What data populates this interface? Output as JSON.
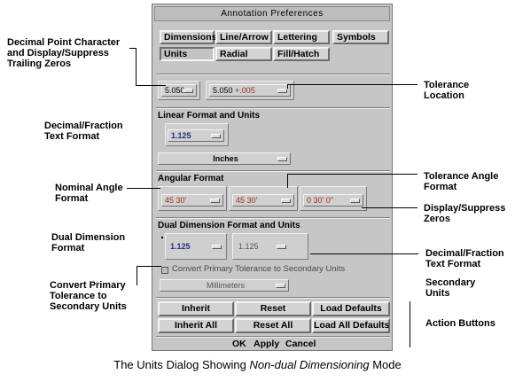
{
  "dialog": {
    "title": "Annotation Preferences",
    "tabs_row1": [
      "Dimensions",
      "Line/Arrow",
      "Lettering",
      "Symbols"
    ],
    "tabs_row2": [
      "Units",
      "Radial",
      "Fill/Hatch"
    ],
    "decimal_point_value": "5.050",
    "tolerance_value_main": "5.050",
    "tolerance_value_suffix": "+.005",
    "linear_section": "Linear Format and Units",
    "linear_value": "1.125",
    "linear_units": "Inches",
    "angular_section": "Angular Format",
    "angle_1": "45 30'",
    "angle_2": "45 30'",
    "angle_3": "0 30' 0\"",
    "dual_section": "Dual Dimension Format and Units",
    "dual_value_1": "1.125",
    "dual_value_2": "1.125",
    "convert_label": "Convert Primary Tolerance to Secondary Units",
    "secondary_units": "Millimeters",
    "actions": {
      "inherit": "Inherit",
      "reset": "Reset",
      "load_defaults": "Load Defaults",
      "inherit_all": "Inherit All",
      "reset_all": "Reset All",
      "load_all_defaults": "Load All Defaults"
    },
    "bottom": {
      "ok": "OK",
      "apply": "Apply",
      "cancel": "Cancel"
    }
  },
  "callouts": {
    "decimal_point": [
      "Decimal Point Character",
      "and Display/Suppress",
      "Trailing Zeros"
    ],
    "decimal_fraction_left": [
      "Decimal/Fraction",
      "Text Format"
    ],
    "nominal_angle": [
      "Nominal Angle",
      "Format"
    ],
    "dual_dimension": [
      "Dual Dimension",
      "Format"
    ],
    "convert_primary": [
      "Convert Primary",
      "Tolerance to",
      "Secondary Units"
    ],
    "tolerance_location": [
      "Tolerance",
      "Location"
    ],
    "tolerance_angle": [
      "Tolerance Angle",
      "Format"
    ],
    "display_suppress": [
      "Display/Suppress",
      "Zeros"
    ],
    "decimal_fraction_right": [
      "Decimal/Fraction",
      "Text Format"
    ],
    "secondary_units": [
      "Secondary",
      "Units"
    ],
    "action_buttons": [
      "Action Buttons"
    ]
  },
  "caption": {
    "prefix": "The Units Dialog Showing ",
    "emphasis": "Non-dual Dimensioning",
    "suffix": " Mode"
  }
}
